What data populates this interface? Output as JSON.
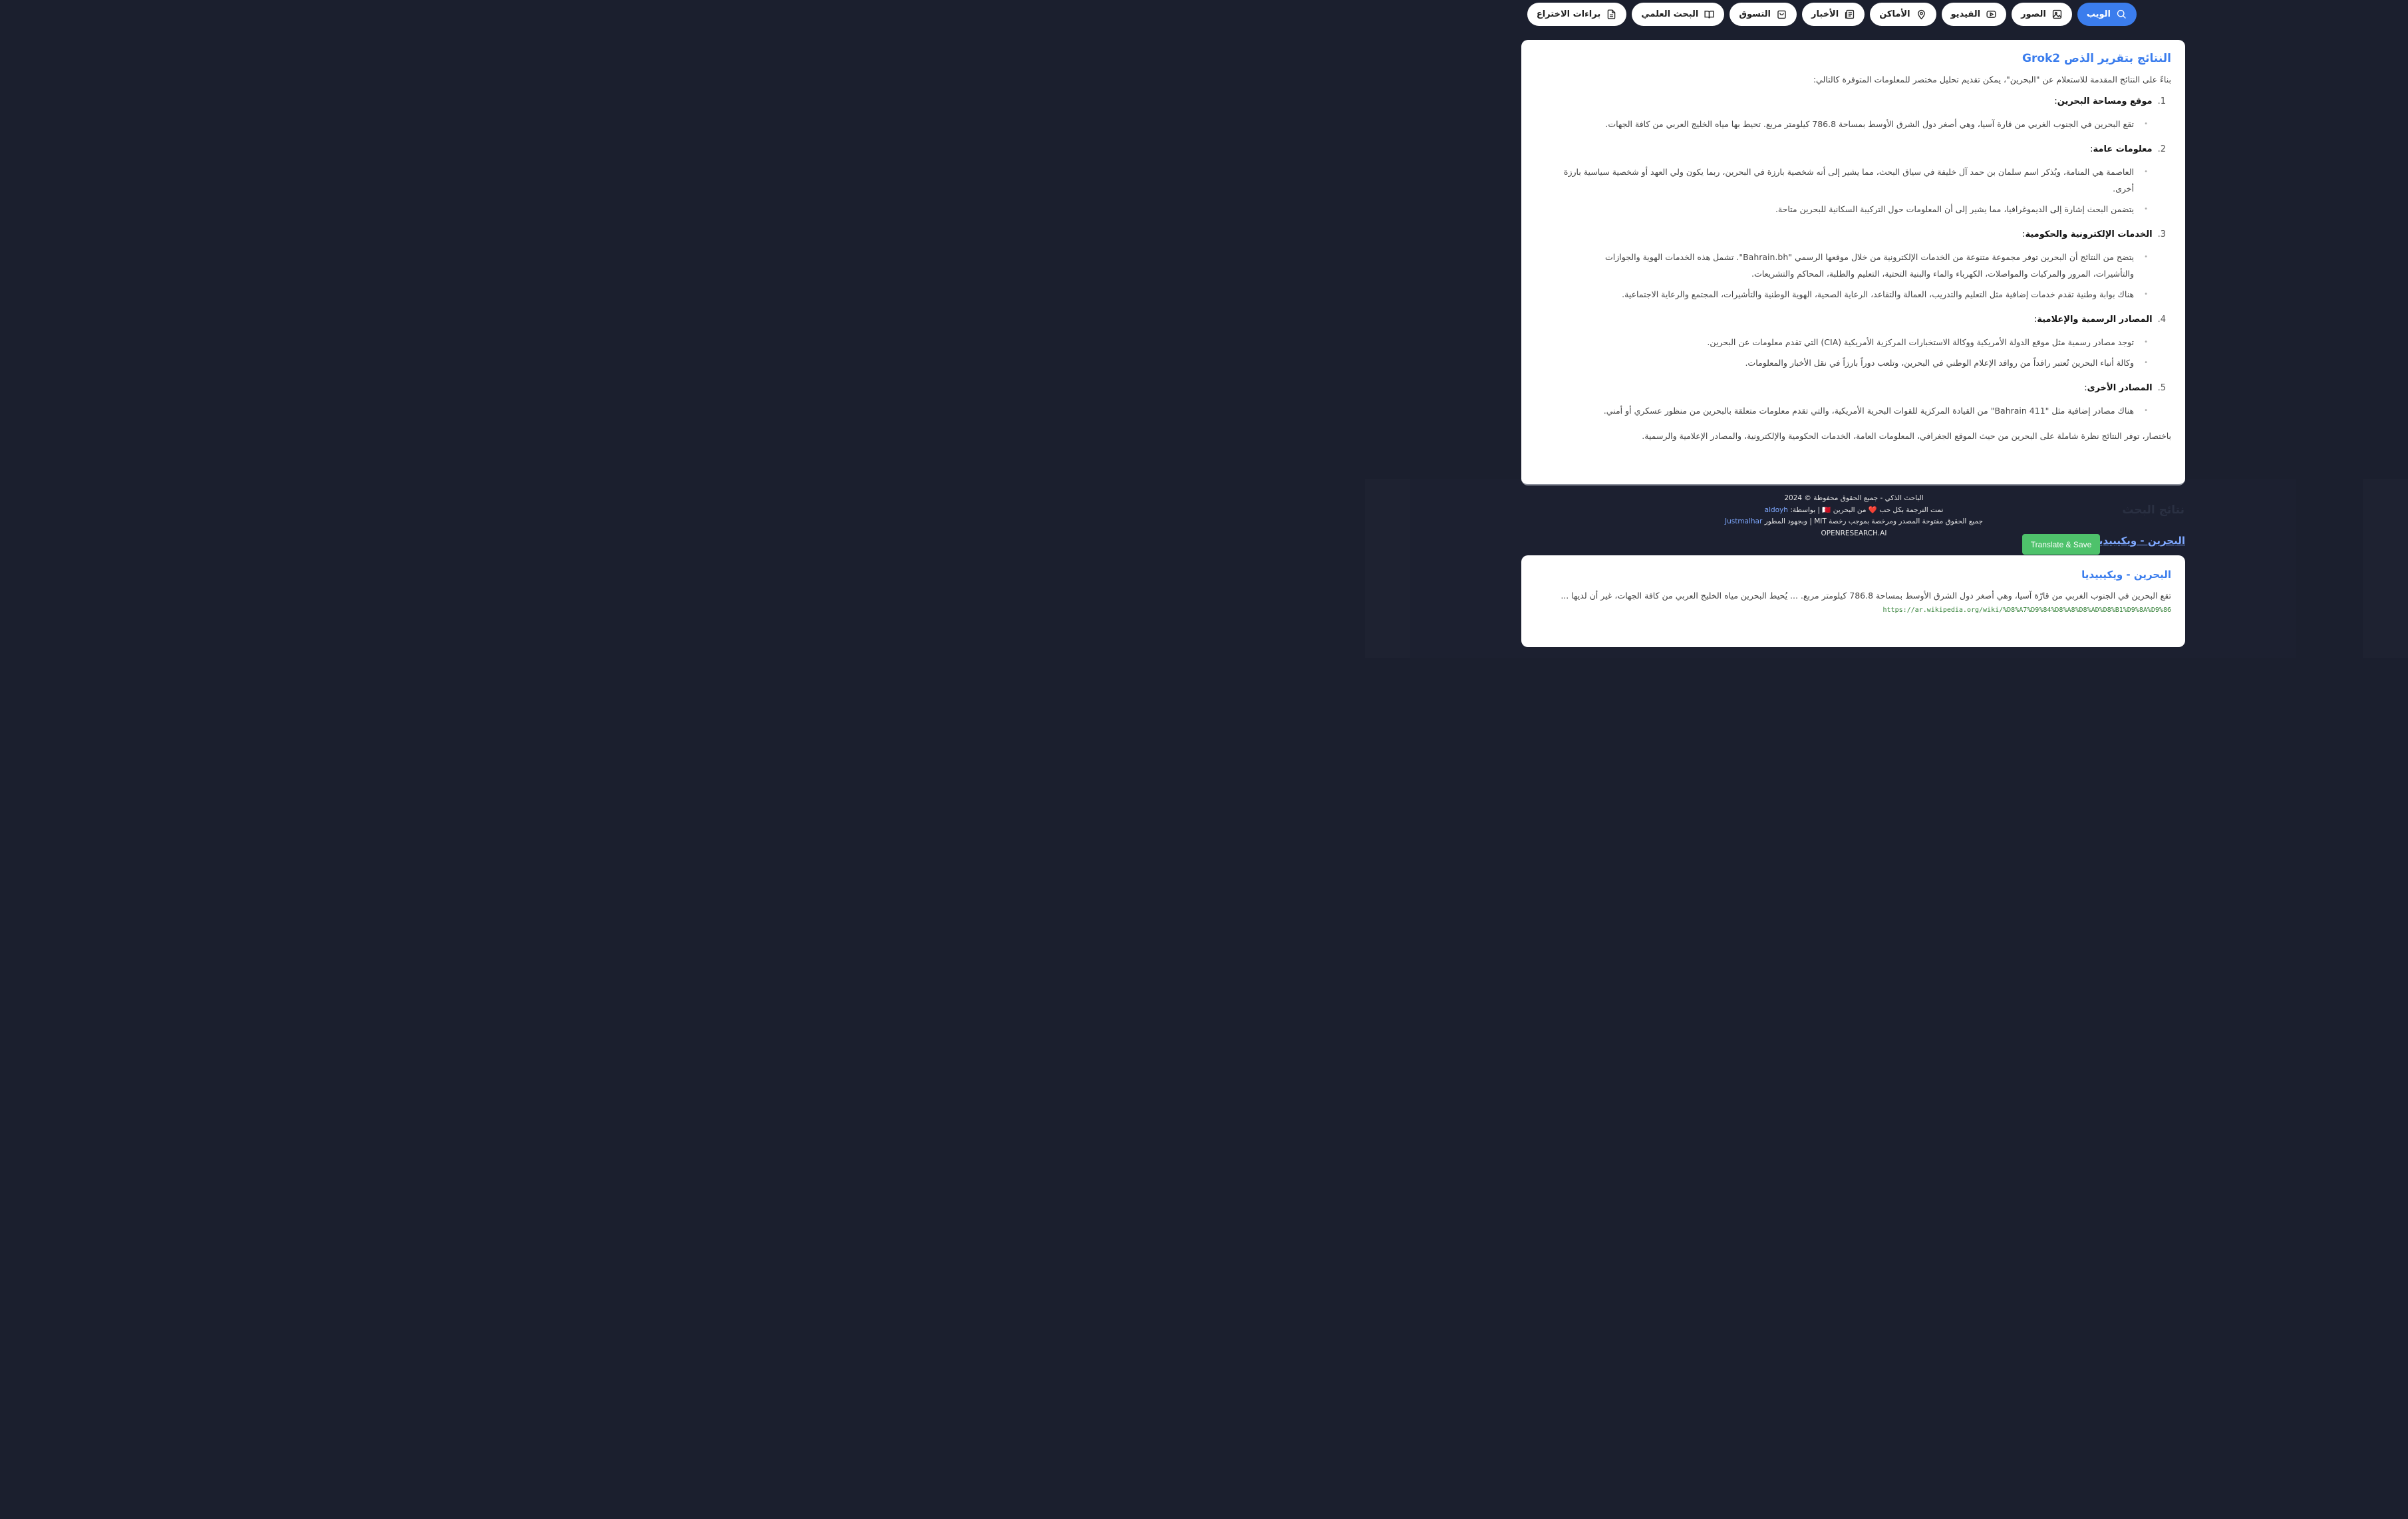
{
  "tabs": [
    {
      "label": "الويب",
      "icon": "search-icon",
      "active": true
    },
    {
      "label": "الصور",
      "icon": "image-icon",
      "active": false
    },
    {
      "label": "الفيديو",
      "icon": "video-icon",
      "active": false
    },
    {
      "label": "الأماكن",
      "icon": "location-pin-icon",
      "active": false
    },
    {
      "label": "الأخبار",
      "icon": "newspaper-icon",
      "active": false
    },
    {
      "label": "التسوق",
      "icon": "shopping-bag-icon",
      "active": false
    },
    {
      "label": "البحث العلمي",
      "icon": "book-icon",
      "active": false
    },
    {
      "label": "براءات الاختراع",
      "icon": "document-icon",
      "active": false
    }
  ],
  "report": {
    "title": "النتائج بتقرير الذص Grok2",
    "intro": "بناءً على النتائج المقدمة للاستعلام عن \"البحرين\"، يمكن تقديم تحليل مختصر للمعلومات المتوفرة كالتالي:",
    "sections": [
      {
        "num": "1.",
        "title": "موقع ومساحة البحرين",
        "bullets": [
          "تقع البحرين في الجنوب الغربي من قارة آسيا، وهي أصغر دول الشرق الأوسط بمساحة 786.8 كيلومتر مربع. تحيط بها مياه الخليج العربي من كافة الجهات."
        ]
      },
      {
        "num": "2.",
        "title": "معلومات عامة",
        "bullets": [
          "العاصمة هي المنامة، ويُذكر اسم سلمان بن حمد آل خليفة في سياق البحث، مما يشير إلى أنه شخصية بارزة في البحرين، ربما يكون ولي العهد أو شخصية سياسية بارزة أخرى.",
          "يتضمن البحث إشارة إلى الديموغرافيا، مما يشير إلى أن المعلومات حول التركيبة السكانية للبحرين متاحة."
        ]
      },
      {
        "num": "3.",
        "title": "الخدمات الإلكترونية والحكومية",
        "bullets": [
          "يتضح من النتائج أن البحرين توفر مجموعة متنوعة من الخدمات الإلكترونية من خلال موقعها الرسمي \"Bahrain.bh\". تشمل هذه الخدمات الهوية والجوازات والتأشيرات، المرور والمركبات والمواصلات، الكهرباء والماء والبنية التحتية، التعليم والطلبة، المحاكم والتشريعات.",
          "هناك بوابة وطنية تقدم خدمات إضافية مثل التعليم والتدريب، العمالة والتقاعد، الرعاية الصحية، الهوية الوطنية والتأشيرات، المجتمع والرعاية الاجتماعية."
        ]
      },
      {
        "num": "4.",
        "title": "المصادر الرسمية والإعلامية",
        "bullets": [
          "توجد مصادر رسمية مثل موقع الدولة الأمريكية ووكالة الاستخبارات المركزية الأمريكية (CIA) التي تقدم معلومات عن البحرين.",
          "وكالة أنباء البحرين تُعتبر رافداً من روافد الإعلام الوطني في البحرين، وتلعب دوراً بارزاً في نقل الأخبار والمعلومات."
        ]
      },
      {
        "num": "5.",
        "title": "المصادر الأخرى",
        "bullets": [
          "هناك مصادر إضافية مثل \"Bahrain 411\" من القيادة المركزية للقوات البحرية الأمريكية، والتي تقدم معلومات متعلقة بالبحرين من منظور عسكري أو أمني."
        ]
      }
    ],
    "summary": "باختصار، توفر النتائج نظرة شاملة على البحرين من حيث الموقع الجغرافي، المعلومات العامة، الخدمات الحكومية والإلكترونية، والمصادر الإعلامية والرسمية."
  },
  "footer": {
    "line1": "الباحث الذكي - جميع الحقوق محفوظة © 2024",
    "line2_prefix": "تمت الترجمة بكل حب ❤️ من البحرين 🇧🇭 | بواسطة:",
    "line2_link": "aldoyh",
    "line3_prefix": "جميع الحقوق مفتوحة المصدر ومرخصة بموجب رخصة MIT | وبجهود المطور",
    "line3_link": "Justmalhar",
    "line4": "OPENRESEARCH.AI"
  },
  "results": {
    "section_title": "نتائج البحث",
    "link_title": "البحرين - ويكيبيديا",
    "translate_label": "Translate & Save",
    "card": {
      "title": "البحرين - ويكيبيديا",
      "snippet": "تقع البحرين في الجنوب الغربي من قارّة آسيا، وهي أصغر دول الشرق الأوسط بمساحة 786.8 كيلومتر مربع. ... يُحيط البحرين مياه الخليج العربي من كافة الجهات، غير أن لديها ...",
      "url": "https://ar.wikipedia.org/wiki/%D8%A7%D9%84%D8%A8%D8%AD%D8%B1%D9%8A%D9%86"
    }
  },
  "colors": {
    "accent": "#3b7ded",
    "background": "#1b1f2e",
    "button_green": "#4ec26b",
    "url_green": "#2e7d32"
  }
}
